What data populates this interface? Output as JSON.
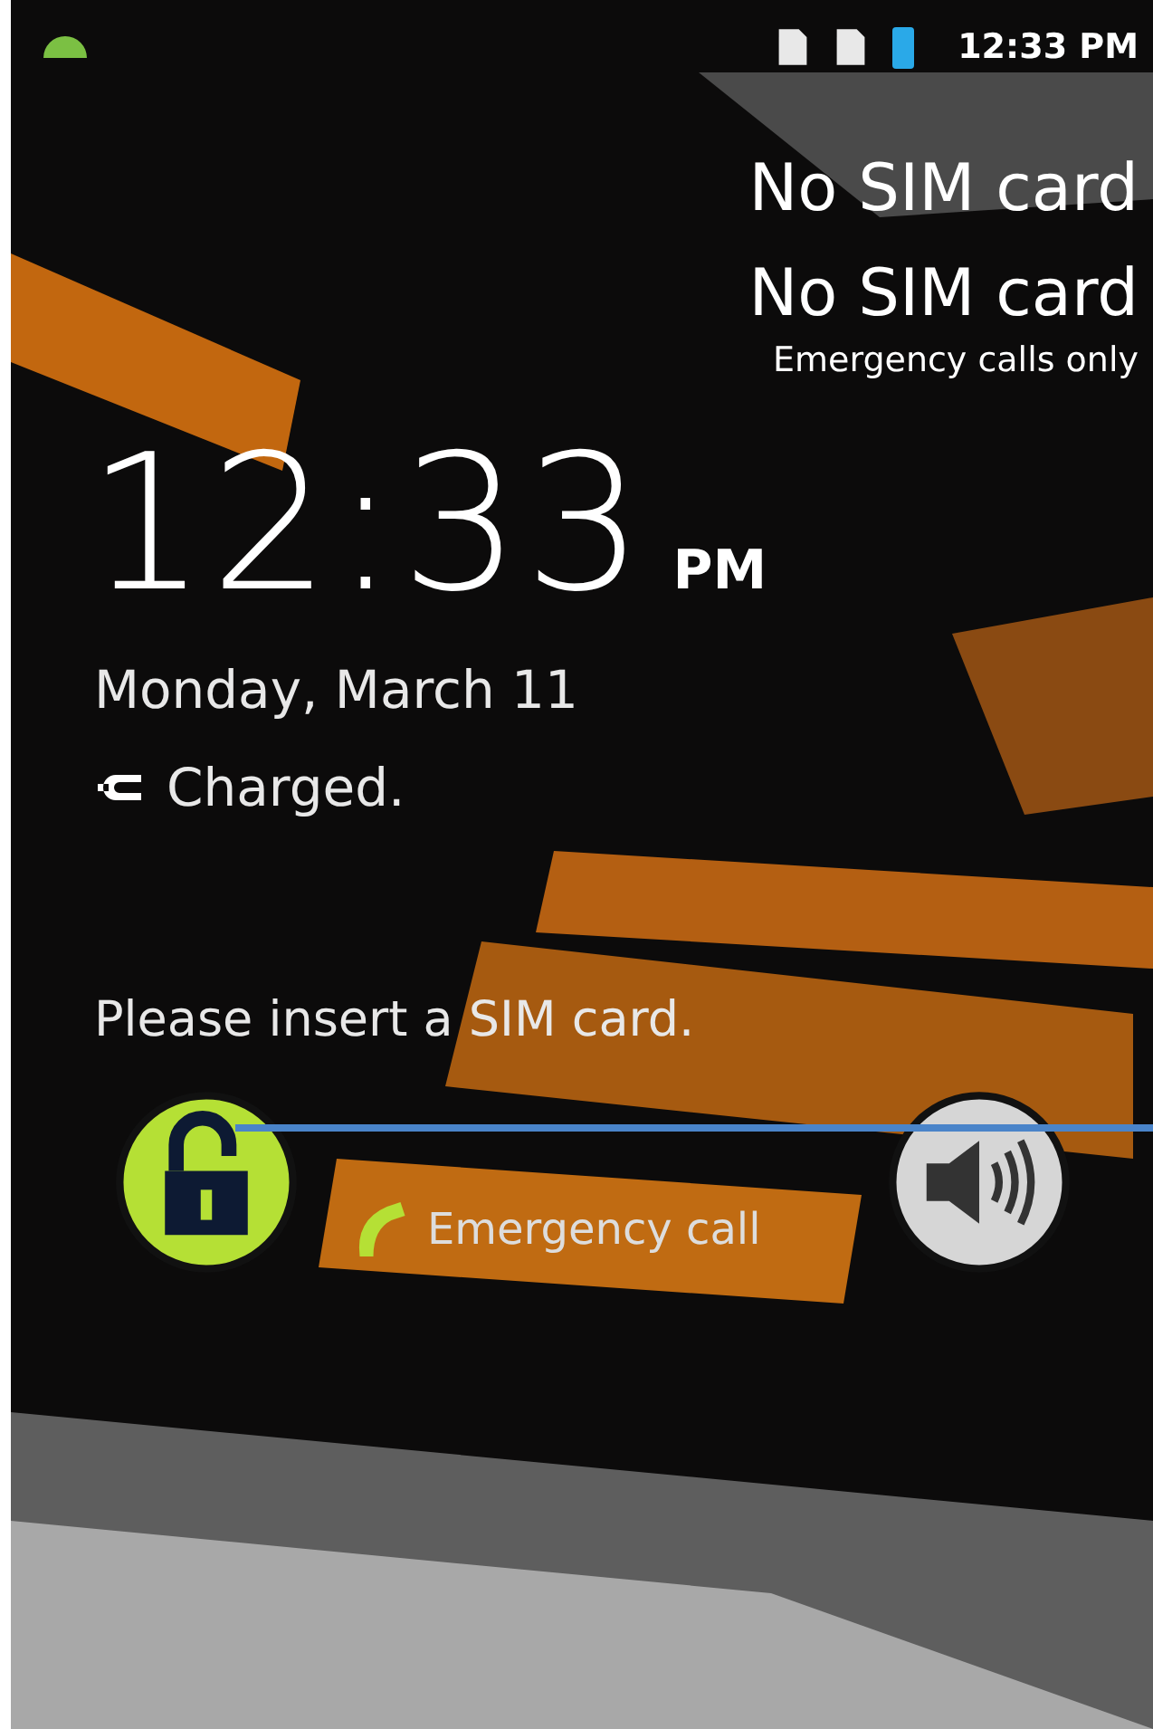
{
  "status_bar": {
    "time": "12:33 PM"
  },
  "carrier_lines": [
    "No SIM card",
    "No SIM card"
  ],
  "network_status": "Emergency calls only",
  "clock": {
    "time": "12:33",
    "ampm": "PM"
  },
  "date": "Monday, March 11",
  "battery": {
    "status": "Charged."
  },
  "message": "Please insert a SIM card.",
  "controls": {
    "emergency_call": "Emergency call",
    "sound_on": true
  }
}
